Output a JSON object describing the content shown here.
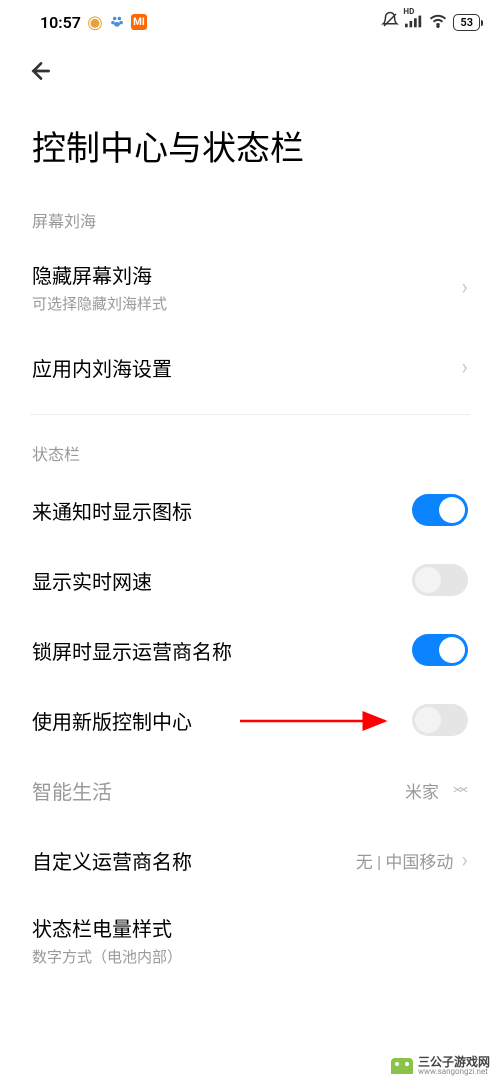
{
  "statusBar": {
    "time": "10:57",
    "miLabel": "MI",
    "battery": "53",
    "hdLabel": "HD"
  },
  "page": {
    "title": "控制中心与状态栏"
  },
  "sections": {
    "notch": {
      "header": "屏幕刘海",
      "hideNotch": {
        "title": "隐藏屏幕刘海",
        "sub": "可选择隐藏刘海样式"
      },
      "inAppNotch": {
        "title": "应用内刘海设置"
      }
    },
    "statusSection": {
      "header": "状态栏",
      "showNotifIcon": {
        "title": "来通知时显示图标",
        "on": true
      },
      "showNetSpeed": {
        "title": "显示实时网速",
        "on": false
      },
      "showCarrierLock": {
        "title": "锁屏时显示运营商名称",
        "on": true
      },
      "useNewControl": {
        "title": "使用新版控制中心",
        "on": false
      },
      "smartLife": {
        "title": "智能生活",
        "value": "米家"
      },
      "customCarrier": {
        "title": "自定义运营商名称",
        "value": "无 | 中国移动"
      },
      "batteryStyle": {
        "title": "状态栏电量样式",
        "sub": "数字方式（电池内部）"
      }
    }
  },
  "watermark": {
    "title": "三公子游戏网",
    "url": "www.sangongzi.net"
  }
}
